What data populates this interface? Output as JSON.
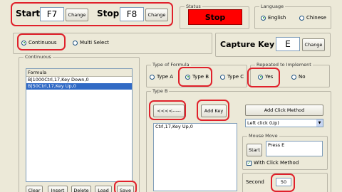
{
  "top": {
    "start_label": "Start",
    "start_key": "F7",
    "start_change": "Change",
    "stop_label": "Stop",
    "stop_key": "F8",
    "stop_change": "Change"
  },
  "status": {
    "group_label": "Status",
    "value": "Stop",
    "color": "#ff0000"
  },
  "language": {
    "group_label": "Language",
    "options": [
      "English",
      "Chinese"
    ],
    "selected": "English"
  },
  "mode": {
    "options": [
      "Continuous",
      "Multi Select"
    ],
    "selected": "Continuous"
  },
  "capture": {
    "label": "Capture Key",
    "key": "E",
    "change": "Change"
  },
  "continuous": {
    "group_label": "Continuous",
    "list_header": "Formula",
    "items": [
      "B|1000Ctrl,17,Key Down,0",
      "B|50Ctrl,17,Key Up,0"
    ],
    "selected_index": 1,
    "buttons": [
      "Clear",
      "Insert",
      "Delete",
      "Load",
      "Save"
    ]
  },
  "formula_type": {
    "group_label": "Type of Formula",
    "options": [
      "Type A",
      "Type B",
      "Type C"
    ],
    "selected": "Type B"
  },
  "repeat": {
    "group_label": "Repeated to Implement",
    "options": [
      "Yes",
      "No"
    ],
    "selected": "Yes"
  },
  "typeb": {
    "group_label": "Type B",
    "arrow_button": "<<<<-----",
    "add_key_button": "Add Key",
    "list_items": [
      "Ctrl,17,Key Up,0"
    ],
    "add_click_button": "Add Click Method",
    "click_select_value": "Left click (Up)"
  },
  "mouse_move": {
    "group_label": "Mouse Move",
    "start_button": "Start",
    "text_value": "Press E",
    "checkbox_label": "With Click Method",
    "checked": true
  },
  "second": {
    "label": "Second",
    "value": "50"
  },
  "highlight_color": "#e0212b"
}
